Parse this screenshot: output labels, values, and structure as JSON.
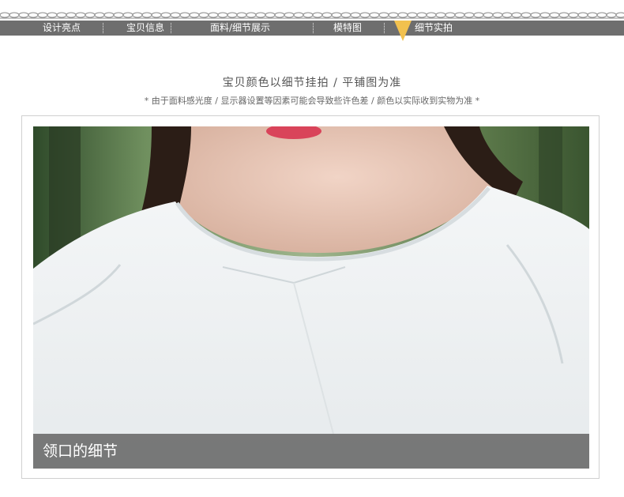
{
  "nav": {
    "items": [
      {
        "label": "设计亮点"
      },
      {
        "label": "宝贝信息"
      },
      {
        "label": "面料/细节展示"
      },
      {
        "label": "模特图"
      },
      {
        "label": "细节实拍"
      }
    ],
    "active_index": 4,
    "bar_color": "#6e6e6e",
    "marker_color": "#f2c14e"
  },
  "intro": {
    "heading": "宝贝颜色以细节挂拍 / 平铺图为准",
    "subheading": "* 由于面料感光度 / 显示器设置等因素可能会导致些许色差 / 颜色以实际收到实物为准 *"
  },
  "photo": {
    "caption": "领口的细节",
    "subject": "white linen top neckline close-up"
  }
}
